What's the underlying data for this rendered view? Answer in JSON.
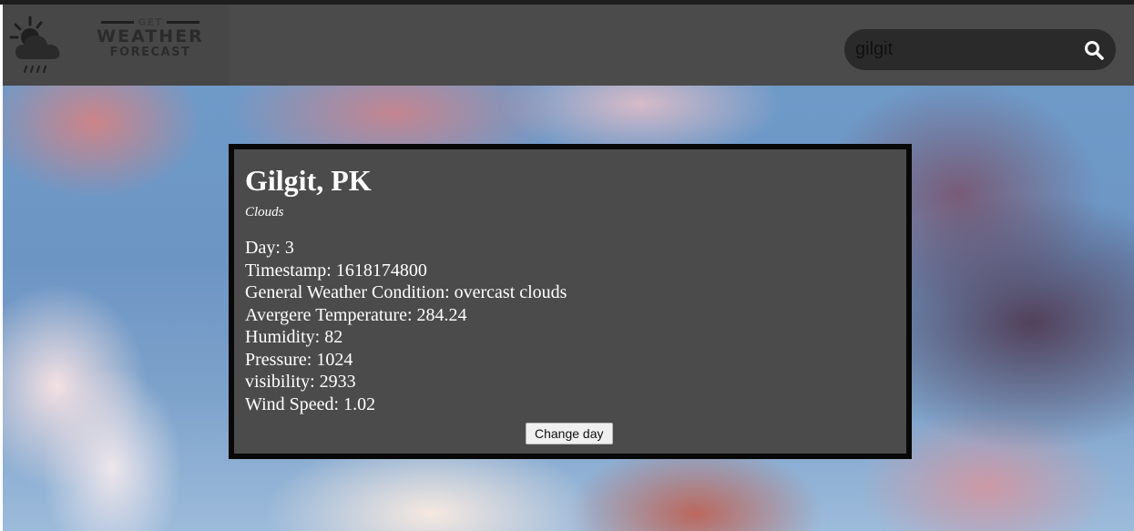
{
  "header": {
    "logo": {
      "icon": "weather-cloud-sun-rain-icon",
      "line1": "GET",
      "line2": "WEATHER",
      "line3": "FORECAST"
    },
    "search": {
      "value": "gilgit",
      "placeholder": "",
      "button_icon": "search-icon"
    }
  },
  "card": {
    "city": "Gilgit, PK",
    "condition": "Clouds",
    "details": [
      "Day: 3",
      "Timestamp: 1618174800",
      "General Weather Condition: overcast clouds",
      "Avergere Temperature: 284.24",
      "Humidity: 82",
      "Pressure: 1024",
      "visibility: 2933",
      "Wind Speed: 1.02"
    ],
    "change_day_label": "Change day"
  },
  "colors": {
    "header_bg": "#4b4b4b",
    "card_bg": "#4b4b4b",
    "card_border": "#080808",
    "search_bg": "#2b2a2b"
  }
}
